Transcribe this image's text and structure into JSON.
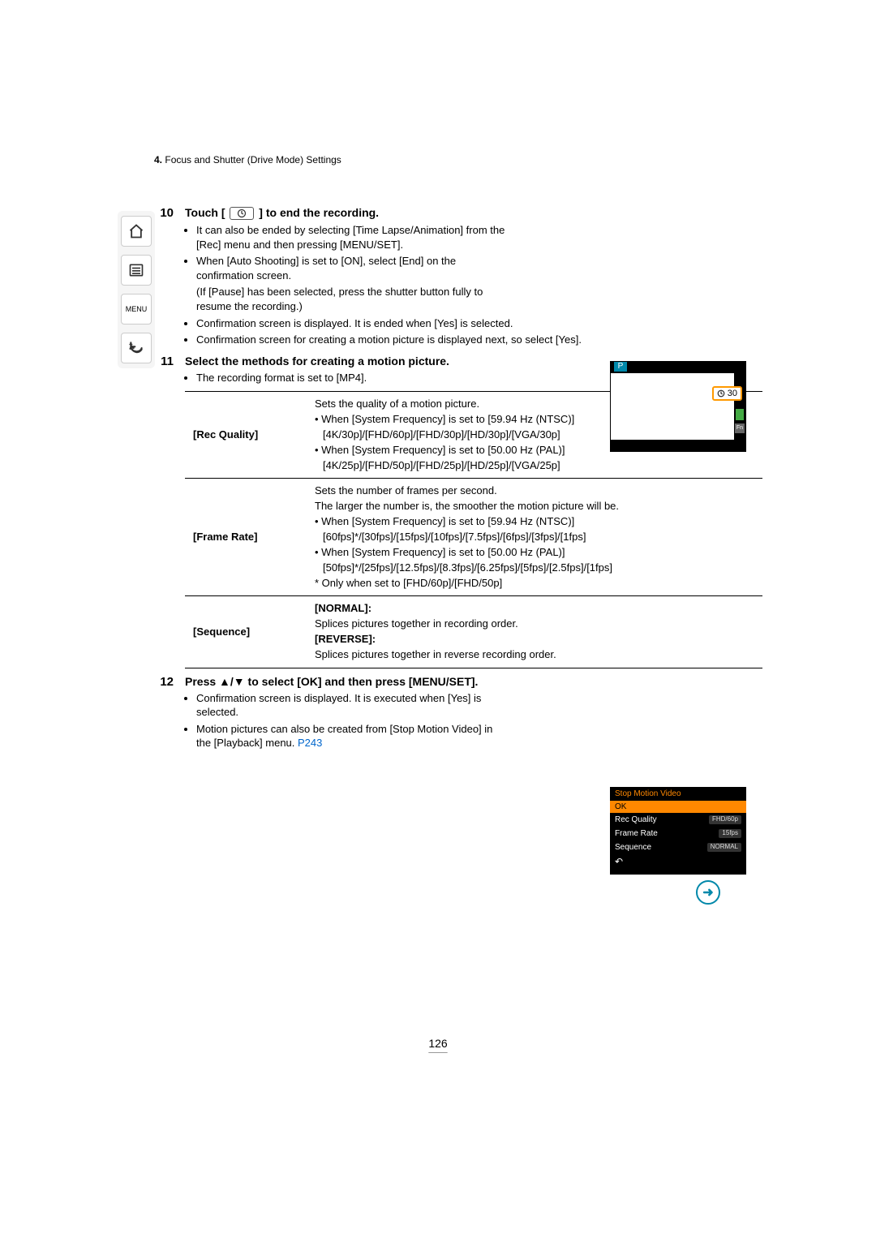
{
  "breadcrumb": {
    "num": "4.",
    "text": "Focus and Shutter (Drive Mode) Settings"
  },
  "sidebar": {
    "home": "⌂",
    "contents_icon": "≡",
    "menu_label": "MENU",
    "back": "↩"
  },
  "thumb1": {
    "mode": "P",
    "overlay_count": "30",
    "fn": "Fn"
  },
  "step10": {
    "num": "10",
    "title_pre": "Touch [",
    "title_post": "] to end the recording.",
    "b1": "It can also be ended by selecting [Time Lapse/Animation] from the [Rec] menu and then pressing [MENU/SET].",
    "b2": "When [Auto Shooting] is set to [ON], select [End] on the confirmation screen.",
    "b2_sub": "(If [Pause] has been selected, press the shutter button fully to resume the recording.)",
    "b3": "Confirmation screen is displayed. It is ended when [Yes] is selected.",
    "b4": "Confirmation screen for creating a motion picture is displayed next, so select [Yes]."
  },
  "step11": {
    "num": "11",
    "title": "Select the methods for creating a motion picture.",
    "b1": "The recording format is set to [MP4]."
  },
  "table": {
    "rec_quality": {
      "key": "[Rec Quality]",
      "l1": "Sets the quality of a motion picture.",
      "l2": "• When [System Frequency] is set to [59.94 Hz (NTSC)]",
      "l3": "[4K/30p]/[FHD/60p]/[FHD/30p]/[HD/30p]/[VGA/30p]",
      "l4": "• When [System Frequency] is set to [50.00 Hz (PAL)]",
      "l5": "[4K/25p]/[FHD/50p]/[FHD/25p]/[HD/25p]/[VGA/25p]"
    },
    "frame_rate": {
      "key": "[Frame Rate]",
      "l1": "Sets the number of frames per second.",
      "l2": "The larger the number is, the smoother the motion picture will be.",
      "l3": "• When [System Frequency] is set to [59.94 Hz (NTSC)]",
      "l4": "[60fps]*/[30fps]/[15fps]/[10fps]/[7.5fps]/[6fps]/[3fps]/[1fps]",
      "l5": "• When [System Frequency] is set to [50.00 Hz (PAL)]",
      "l6": "[50fps]*/[25fps]/[12.5fps]/[8.3fps]/[6.25fps]/[5fps]/[2.5fps]/[1fps]",
      "l7": "* Only when set to [FHD/60p]/[FHD/50p]"
    },
    "sequence": {
      "key": "[Sequence]",
      "normal_t": "[NORMAL]:",
      "normal_d": "Splices pictures together in recording order.",
      "reverse_t": "[REVERSE]:",
      "reverse_d": "Splices pictures together in reverse recording order."
    }
  },
  "step12": {
    "num": "12",
    "title": "Press ▲/▼ to select [OK] and then press [MENU/SET].",
    "b1": "Confirmation screen is displayed. It is executed when [Yes] is selected.",
    "b2_pre": "Motion pictures can also be created from [Stop Motion Video] in the [Playback] menu. ",
    "b2_link": "P243"
  },
  "thumb2": {
    "title": "Stop Motion Video",
    "ok": "OK",
    "r1k": "Rec Quality",
    "r1v": "FHD/60p",
    "r2k": "Frame Rate",
    "r2v": "15fps",
    "r3k": "Sequence",
    "r3v": "NORMAL"
  },
  "page_number": "126",
  "arrow": "➜"
}
